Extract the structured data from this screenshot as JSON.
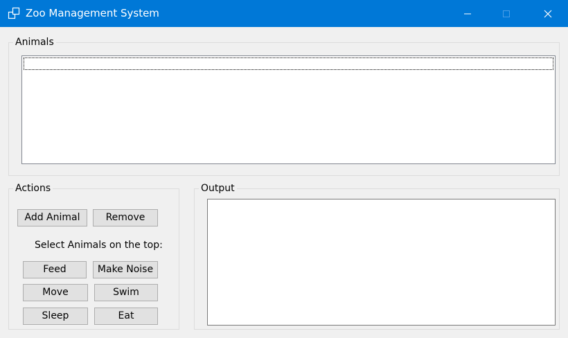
{
  "window": {
    "title": "Zoo Management System",
    "app_icon": "windows-app-icon",
    "accent_color": "#0078d7"
  },
  "animals": {
    "group_label": "Animals",
    "items": []
  },
  "actions": {
    "group_label": "Actions",
    "add_label": "Add Animal",
    "remove_label": "Remove",
    "hint": "Select Animals on the top:",
    "feed_label": "Feed",
    "make_noise_label": "Make Noise",
    "move_label": "Move",
    "swim_label": "Swim",
    "sleep_label": "Sleep",
    "eat_label": "Eat"
  },
  "output": {
    "group_label": "Output",
    "text": ""
  }
}
